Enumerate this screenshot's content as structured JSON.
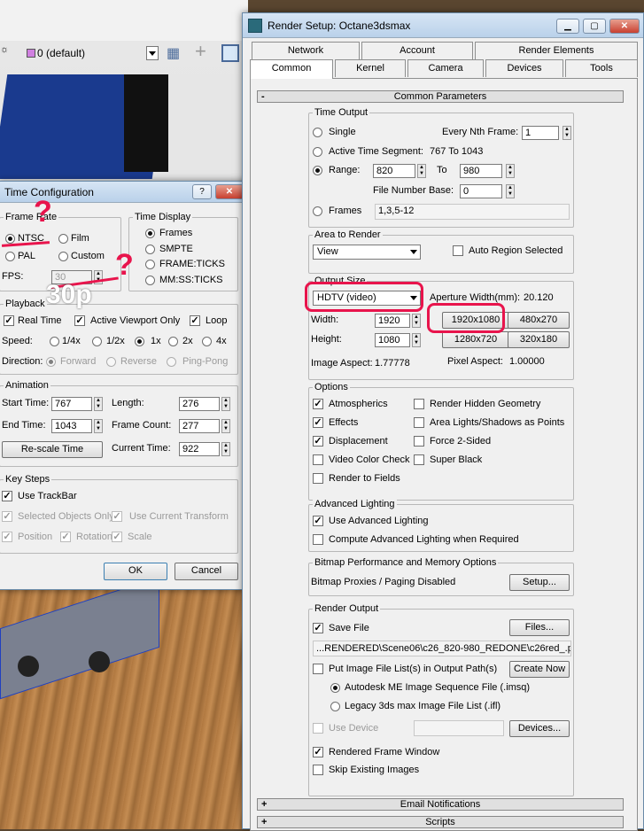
{
  "viewport": {
    "layer_label": "0 (default)",
    "overlay_text": "30p"
  },
  "time_config": {
    "title": "Time Configuration",
    "frame_rate": {
      "label": "Frame Rate",
      "ntsc": "NTSC",
      "film": "Film",
      "pal": "PAL",
      "custom": "Custom",
      "fps_label": "FPS:",
      "fps_value": "30",
      "selected": "NTSC"
    },
    "time_display": {
      "label": "Time Display",
      "frames": "Frames",
      "smpte": "SMPTE",
      "frame_ticks": "FRAME:TICKS",
      "mm_ss_ticks": "MM:SS:TICKS",
      "selected": "Frames"
    },
    "playback": {
      "label": "Playback",
      "real_time": "Real Time",
      "active_viewport_only": "Active Viewport Only",
      "loop": "Loop",
      "speed_label": "Speed:",
      "speeds": [
        "1/4x",
        "1/2x",
        "1x",
        "2x",
        "4x"
      ],
      "speed_selected": "1x",
      "direction_label": "Direction:",
      "directions": [
        "Forward",
        "Reverse",
        "Ping-Pong"
      ]
    },
    "animation": {
      "label": "Animation",
      "start_time_label": "Start Time:",
      "start_time": "767",
      "length_label": "Length:",
      "length": "276",
      "end_time_label": "End Time:",
      "end_time": "1043",
      "frame_count_label": "Frame Count:",
      "frame_count": "277",
      "rescale_button": "Re-scale Time",
      "current_time_label": "Current Time:",
      "current_time": "922"
    },
    "key_steps": {
      "label": "Key Steps",
      "use_trackbar": "Use TrackBar",
      "selected_objects_only": "Selected Objects Only",
      "use_current_transform": "Use Current Transform",
      "position": "Position",
      "rotation": "Rotation",
      "scale": "Scale"
    },
    "ok": "OK",
    "cancel": "Cancel"
  },
  "render_setup": {
    "title": "Render Setup: Octane3dsmax",
    "tabs_row1": [
      "Network",
      "Account",
      "Render Elements"
    ],
    "tabs_row2": [
      "Common",
      "Kernel",
      "Camera",
      "Devices",
      "Tools"
    ],
    "active_tab": "Common",
    "common_params_label": "Common Parameters",
    "time_output": {
      "label": "Time Output",
      "single": "Single",
      "every_nth_label": "Every Nth Frame:",
      "every_nth": "1",
      "active_segment": "Active Time Segment:",
      "active_segment_value": "767 To 1043",
      "range": "Range:",
      "range_from": "820",
      "range_to_label": "To",
      "range_to": "980",
      "file_number_base_label": "File Number Base:",
      "file_number_base": "0",
      "frames": "Frames",
      "frames_value": "1,3,5-12",
      "selected": "Range"
    },
    "area_to_render": {
      "label": "Area to Render",
      "value": "View",
      "auto_region": "Auto Region Selected"
    },
    "output_size": {
      "label": "Output Size",
      "preset": "HDTV (video)",
      "aperture_label": "Aperture Width(mm):",
      "aperture_value": "20.120",
      "width_label": "Width:",
      "width": "1920",
      "height_label": "Height:",
      "height": "1080",
      "presets": [
        "1920x1080",
        "480x270",
        "1280x720",
        "320x180"
      ],
      "image_aspect_label": "Image Aspect:",
      "image_aspect": "1.77778",
      "pixel_aspect_label": "Pixel Aspect:",
      "pixel_aspect": "1.00000"
    },
    "options": {
      "label": "Options",
      "atmospherics": "Atmospherics",
      "render_hidden": "Render Hidden Geometry",
      "effects": "Effects",
      "area_lights": "Area Lights/Shadows as Points",
      "displacement": "Displacement",
      "force_2sided": "Force 2-Sided",
      "video_color_check": "Video Color Check",
      "super_black": "Super Black",
      "render_to_fields": "Render to Fields"
    },
    "advanced_lighting": {
      "label": "Advanced Lighting",
      "use": "Use Advanced Lighting",
      "compute": "Compute Advanced Lighting when Required"
    },
    "bitmap": {
      "label": "Bitmap Performance and Memory Options",
      "status": "Bitmap Proxies / Paging Disabled",
      "setup_button": "Setup..."
    },
    "render_output": {
      "label": "Render Output",
      "save_file": "Save File",
      "files_button": "Files...",
      "path": "...RENDERED\\Scene06\\c26_820-980_REDONE\\c26red_.png",
      "put_image_list": "Put Image File List(s) in Output Path(s)",
      "create_now": "Create Now",
      "autodesk_seq": "Autodesk ME Image Sequence File (.imsq)",
      "legacy_list": "Legacy 3ds max Image File List (.ifl)",
      "use_device": "Use Device",
      "devices_button": "Devices...",
      "rendered_frame_window": "Rendered Frame Window",
      "skip_existing": "Skip Existing Images"
    },
    "rollouts": [
      "Email Notifications",
      "Scripts"
    ]
  },
  "colors": {
    "annotation": "#e8144c"
  }
}
